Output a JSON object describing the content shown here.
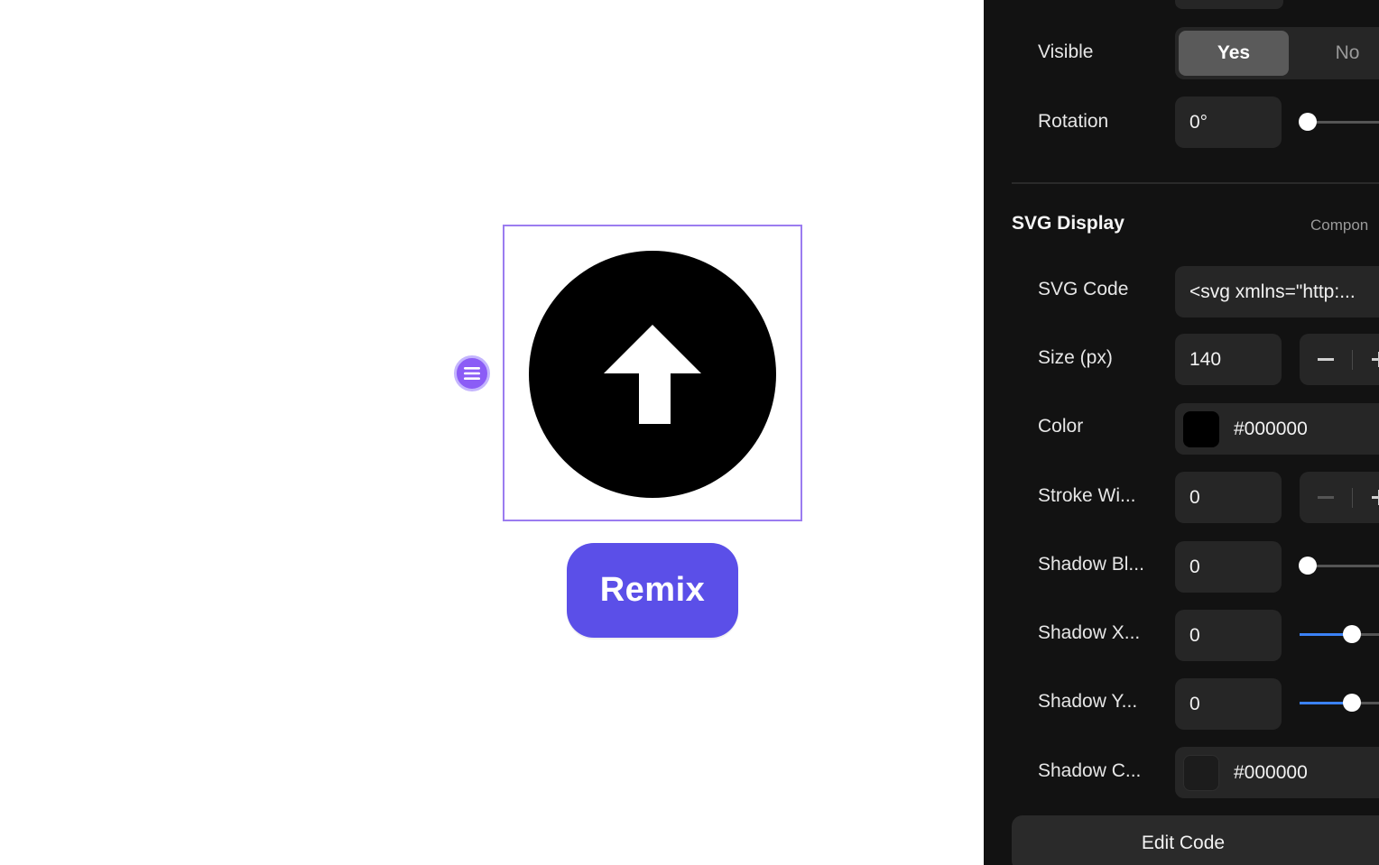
{
  "canvas": {
    "remix_label": "Remix",
    "svg_icon": "arrow-up-circle",
    "selection_color": "#9b7cf0",
    "handle_color": "#8b5cf6",
    "button_color": "#5b4fe8"
  },
  "panel": {
    "visible": {
      "label": "Visible",
      "yes": "Yes",
      "no": "No",
      "selected": "Yes"
    },
    "rotation": {
      "label": "Rotation",
      "value": "0°"
    },
    "section": {
      "title": "SVG Display",
      "link": "Compon"
    },
    "svg_code": {
      "label": "SVG Code",
      "value": "<svg xmlns=\"http:..."
    },
    "size": {
      "label": "Size (px)",
      "value": "140"
    },
    "color": {
      "label": "Color",
      "value": "#000000",
      "swatch": "#000000"
    },
    "stroke_width": {
      "label": "Stroke Wi...",
      "value": "0"
    },
    "shadow_blur": {
      "label": "Shadow Bl...",
      "value": "0"
    },
    "shadow_x": {
      "label": "Shadow X...",
      "value": "0"
    },
    "shadow_y": {
      "label": "Shadow Y...",
      "value": "0"
    },
    "shadow_color": {
      "label": "Shadow C...",
      "value": "#000000",
      "swatch": "#1c1c1c"
    },
    "edit_code_label": "Edit Code",
    "accent_color": "#3b82f6"
  }
}
